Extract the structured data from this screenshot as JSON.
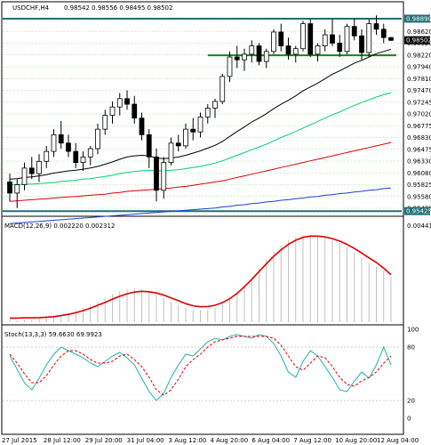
{
  "header": {
    "symbol": "USDCHF,H4",
    "ohlc": "0.98542 0.98556 0.98495 0.98502"
  },
  "price_panel": {
    "tick_labels": [
      "0.98890",
      "0.98620",
      "0.98520",
      "0.98220",
      "0.97940",
      "0.97810",
      "0.97470",
      "0.97245",
      "0.97020",
      "0.96775",
      "0.96830",
      "0.96475",
      "0.96330",
      "0.96080",
      "0.95825",
      "0.95580",
      "0.95425"
    ],
    "current_price": "0.98502",
    "resistance_level": "0.98890",
    "support_level": "0.95425",
    "colors": {
      "resistance": "#1f6f7a",
      "support": "#0f8a0f",
      "price_tag": "#000000",
      "level_tag": "#1f6f7a"
    }
  },
  "macd_panel": {
    "label": "MACD(12,26,9) 0.002220 0.002312",
    "top_value": "0.00441",
    "colors": {
      "histogram": "#c0c0c0",
      "signal": "#e00000"
    }
  },
  "stoch_panel": {
    "label": "Stoch(13,3,3) 59.6630 69.9923",
    "levels": [
      "100",
      "80",
      "20",
      "0"
    ],
    "colors": {
      "main": "#20b2aa",
      "signal": "#e00000"
    }
  },
  "time_axis": {
    "labels": [
      "27 Jul 2015",
      "28 Jul 12:00",
      "29 Jul 20:00",
      "31 Jul 04:00",
      "3 Aug 12:00",
      "4 Aug 20:00",
      "6 Aug 04:00",
      "7 Aug 12:00",
      "10 Aug 20:00",
      "12 Aug 04:00"
    ]
  },
  "chart_data": {
    "type": "candlestick",
    "symbol": "USDCHF",
    "timeframe": "H4",
    "candles": [
      [
        0.9595,
        0.961,
        0.956,
        0.9575
      ],
      [
        0.9575,
        0.96,
        0.9548,
        0.959
      ],
      [
        0.959,
        0.963,
        0.958,
        0.962
      ],
      [
        0.962,
        0.964,
        0.96,
        0.961
      ],
      [
        0.961,
        0.9645,
        0.9595,
        0.9632
      ],
      [
        0.9632,
        0.966,
        0.962,
        0.965
      ],
      [
        0.965,
        0.969,
        0.964,
        0.968
      ],
      [
        0.968,
        0.9705,
        0.9655,
        0.9665
      ],
      [
        0.9665,
        0.968,
        0.964,
        0.965
      ],
      [
        0.965,
        0.9665,
        0.962,
        0.963
      ],
      [
        0.963,
        0.965,
        0.9615,
        0.964
      ],
      [
        0.964,
        0.966,
        0.9625,
        0.9655
      ],
      [
        0.9655,
        0.97,
        0.9645,
        0.969
      ],
      [
        0.969,
        0.9725,
        0.968,
        0.9715
      ],
      [
        0.9715,
        0.974,
        0.97,
        0.973
      ],
      [
        0.973,
        0.9755,
        0.9715,
        0.9745
      ],
      [
        0.9745,
        0.976,
        0.9725,
        0.9735
      ],
      [
        0.9735,
        0.975,
        0.97,
        0.971
      ],
      [
        0.971,
        0.972,
        0.967,
        0.968
      ],
      [
        0.968,
        0.969,
        0.962,
        0.964
      ],
      [
        0.964,
        0.9655,
        0.956,
        0.958
      ],
      [
        0.958,
        0.964,
        0.9565,
        0.963
      ],
      [
        0.963,
        0.9675,
        0.9625,
        0.9665
      ],
      [
        0.9665,
        0.968,
        0.965,
        0.966
      ],
      [
        0.966,
        0.97,
        0.9655,
        0.969
      ],
      [
        0.969,
        0.971,
        0.967,
        0.9685
      ],
      [
        0.9685,
        0.972,
        0.9675,
        0.9712
      ],
      [
        0.9712,
        0.9735,
        0.97,
        0.9728
      ],
      [
        0.9728,
        0.9745,
        0.971,
        0.974
      ],
      [
        0.974,
        0.979,
        0.9735,
        0.9785
      ],
      [
        0.9785,
        0.983,
        0.9775,
        0.982
      ],
      [
        0.982,
        0.984,
        0.98,
        0.9815
      ],
      [
        0.9815,
        0.9835,
        0.9795,
        0.9825
      ],
      [
        0.9825,
        0.985,
        0.981,
        0.984
      ],
      [
        0.984,
        0.9845,
        0.9805,
        0.9812
      ],
      [
        0.9812,
        0.9835,
        0.98,
        0.983
      ],
      [
        0.983,
        0.987,
        0.9825,
        0.9865
      ],
      [
        0.9865,
        0.988,
        0.983,
        0.984
      ],
      [
        0.984,
        0.9855,
        0.9815,
        0.9825
      ],
      [
        0.9825,
        0.984,
        0.981,
        0.9835
      ],
      [
        0.9835,
        0.9885,
        0.983,
        0.988
      ],
      [
        0.988,
        0.9888,
        0.982,
        0.9825
      ],
      [
        0.9825,
        0.9845,
        0.9812,
        0.984
      ],
      [
        0.984,
        0.987,
        0.983,
        0.986
      ],
      [
        0.986,
        0.9888,
        0.984,
        0.9845
      ],
      [
        0.9845,
        0.986,
        0.982,
        0.983
      ],
      [
        0.983,
        0.988,
        0.9825,
        0.9875
      ],
      [
        0.9875,
        0.9889,
        0.985,
        0.9858
      ],
      [
        0.9858,
        0.987,
        0.9815,
        0.9828
      ],
      [
        0.9828,
        0.9888,
        0.982,
        0.988
      ],
      [
        0.988,
        0.9895,
        0.986,
        0.987
      ],
      [
        0.987,
        0.988,
        0.9845,
        0.9855
      ],
      [
        0.9855,
        0.9856,
        0.9849,
        0.985
      ]
    ],
    "moving_averages": [
      {
        "color": "#000000",
        "values": [
          0.96,
          0.9601,
          0.9603,
          0.9604,
          0.9606,
          0.9608,
          0.9611,
          0.9613,
          0.9615,
          0.9616,
          0.9618,
          0.962,
          0.9623,
          0.9627,
          0.9631,
          0.9636,
          0.964,
          0.9642,
          0.9643,
          0.9642,
          0.9638,
          0.9637,
          0.9638,
          0.964,
          0.9643,
          0.9647,
          0.9651,
          0.9656,
          0.9661,
          0.9668,
          0.9677,
          0.9686,
          0.9694,
          0.9703,
          0.971,
          0.9718,
          0.9727,
          0.9735,
          0.9742,
          0.975,
          0.9759,
          0.9766,
          0.9773,
          0.9781,
          0.9789,
          0.9795,
          0.9802,
          0.9809,
          0.9814,
          0.982,
          0.9826,
          0.983,
          0.9834
        ]
      },
      {
        "color": "#00d16f",
        "values": [
          0.959,
          0.959,
          0.9591,
          0.9591,
          0.9592,
          0.9593,
          0.9594,
          0.9596,
          0.9597,
          0.9598,
          0.96,
          0.9601,
          0.9603,
          0.9605,
          0.9607,
          0.961,
          0.9612,
          0.9614,
          0.9615,
          0.9616,
          0.9615,
          0.9615,
          0.9616,
          0.9617,
          0.9619,
          0.9621,
          0.9623,
          0.9626,
          0.9629,
          0.9633,
          0.9638,
          0.9643,
          0.9648,
          0.9653,
          0.9658,
          0.9663,
          0.9669,
          0.9675,
          0.968,
          0.9686,
          0.9692,
          0.9698,
          0.9704,
          0.971,
          0.9716,
          0.9721,
          0.9727,
          0.9733,
          0.9738,
          0.9743,
          0.9748,
          0.9752,
          0.9756
        ]
      },
      {
        "color": "#e00000",
        "values": [
          0.956,
          0.9561,
          0.9562,
          0.9563,
          0.9564,
          0.9565,
          0.9566,
          0.9567,
          0.9568,
          0.9569,
          0.957,
          0.9571,
          0.9572,
          0.9573,
          0.9575,
          0.9576,
          0.9578,
          0.9579,
          0.958,
          0.9581,
          0.9582,
          0.9583,
          0.9584,
          0.9586,
          0.9587,
          0.9589,
          0.9591,
          0.9593,
          0.9595,
          0.9597,
          0.96,
          0.9603,
          0.9606,
          0.9609,
          0.9612,
          0.9615,
          0.9618,
          0.9621,
          0.9624,
          0.9627,
          0.963,
          0.9633,
          0.9636,
          0.9639,
          0.9642,
          0.9645,
          0.9648,
          0.9651,
          0.9654,
          0.9657,
          0.966,
          0.9663,
          0.9666
        ]
      },
      {
        "color": "#1a3fe0",
        "values": [
          0.952,
          0.9521,
          0.9522,
          0.9523,
          0.9524,
          0.9525,
          0.9526,
          0.9527,
          0.9528,
          0.9529,
          0.953,
          0.9531,
          0.9532,
          0.9533,
          0.9534,
          0.9535,
          0.9536,
          0.9537,
          0.9538,
          0.9539,
          0.954,
          0.9541,
          0.9542,
          0.9543,
          0.9544,
          0.9545,
          0.9546,
          0.9547,
          0.9548,
          0.955,
          0.9551,
          0.9553,
          0.9554,
          0.9556,
          0.9557,
          0.9559,
          0.956,
          0.9562,
          0.9563,
          0.9565,
          0.9566,
          0.9568,
          0.9569,
          0.9571,
          0.9572,
          0.9574,
          0.9575,
          0.9577,
          0.9578,
          0.958,
          0.9581,
          0.9583,
          0.9584
        ]
      }
    ],
    "price_range": [
      0.9538,
      0.9897
    ],
    "macd": {
      "histogram": [
        0.0001,
        0.0001,
        0.00012,
        0.00014,
        0.00016,
        0.0002,
        0.00026,
        0.00034,
        0.00044,
        0.00056,
        0.0007,
        0.00085,
        0.001,
        0.00118,
        0.00136,
        0.0015,
        0.0016,
        0.00164,
        0.0016,
        0.0015,
        0.00135,
        0.00118,
        0.001,
        0.00085,
        0.0007,
        0.0006,
        0.00058,
        0.00062,
        0.00072,
        0.00088,
        0.0011,
        0.0014,
        0.00176,
        0.00218,
        0.00262,
        0.00304,
        0.00342,
        0.00374,
        0.00398,
        0.00414,
        0.00422,
        0.00424,
        0.0042,
        0.00412,
        0.004,
        0.00384,
        0.00364,
        0.0034,
        0.00314,
        0.0029,
        0.0027,
        0.0025,
        0.00222
      ],
      "signal": [
        0.0002,
        0.0002,
        0.00021,
        0.00021,
        0.00022,
        0.00024,
        0.00027,
        0.00032,
        0.00038,
        0.00046,
        0.00056,
        0.00068,
        0.00082,
        0.00096,
        0.00112,
        0.00126,
        0.00138,
        0.00146,
        0.0015,
        0.00148,
        0.00142,
        0.00132,
        0.00118,
        0.00104,
        0.0009,
        0.0008,
        0.00075,
        0.00076,
        0.00082,
        0.00095,
        0.00114,
        0.0014,
        0.00172,
        0.00208,
        0.00246,
        0.00284,
        0.0032,
        0.00352,
        0.00378,
        0.00398,
        0.00412,
        0.00418,
        0.00418,
        0.00414,
        0.00406,
        0.00394,
        0.00378,
        0.00358,
        0.00336,
        0.00312,
        0.0029,
        0.00262,
        0.00231
      ],
      "range": [
        0.0,
        0.00441
      ]
    },
    "stochastic": {
      "main": [
        70,
        55,
        40,
        32,
        45,
        60,
        72,
        80,
        76,
        72,
        68,
        62,
        58,
        64,
        70,
        74,
        68,
        60,
        45,
        30,
        20,
        28,
        46,
        60,
        72,
        70,
        78,
        86,
        90,
        88,
        92,
        94,
        92,
        90,
        94,
        92,
        84,
        70,
        52,
        46,
        64,
        76,
        70,
        58,
        46,
        32,
        30,
        42,
        52,
        45,
        60,
        80,
        60
      ],
      "signal": [
        72,
        62,
        50,
        40,
        40,
        48,
        60,
        70,
        76,
        76,
        72,
        66,
        62,
        62,
        64,
        70,
        72,
        66,
        58,
        46,
        32,
        26,
        32,
        44,
        58,
        66,
        72,
        80,
        86,
        88,
        90,
        92,
        92,
        92,
        92,
        92,
        90,
        82,
        70,
        58,
        54,
        62,
        70,
        68,
        58,
        46,
        38,
        36,
        42,
        46,
        52,
        62,
        70
      ],
      "range": [
        0,
        100
      ]
    }
  }
}
